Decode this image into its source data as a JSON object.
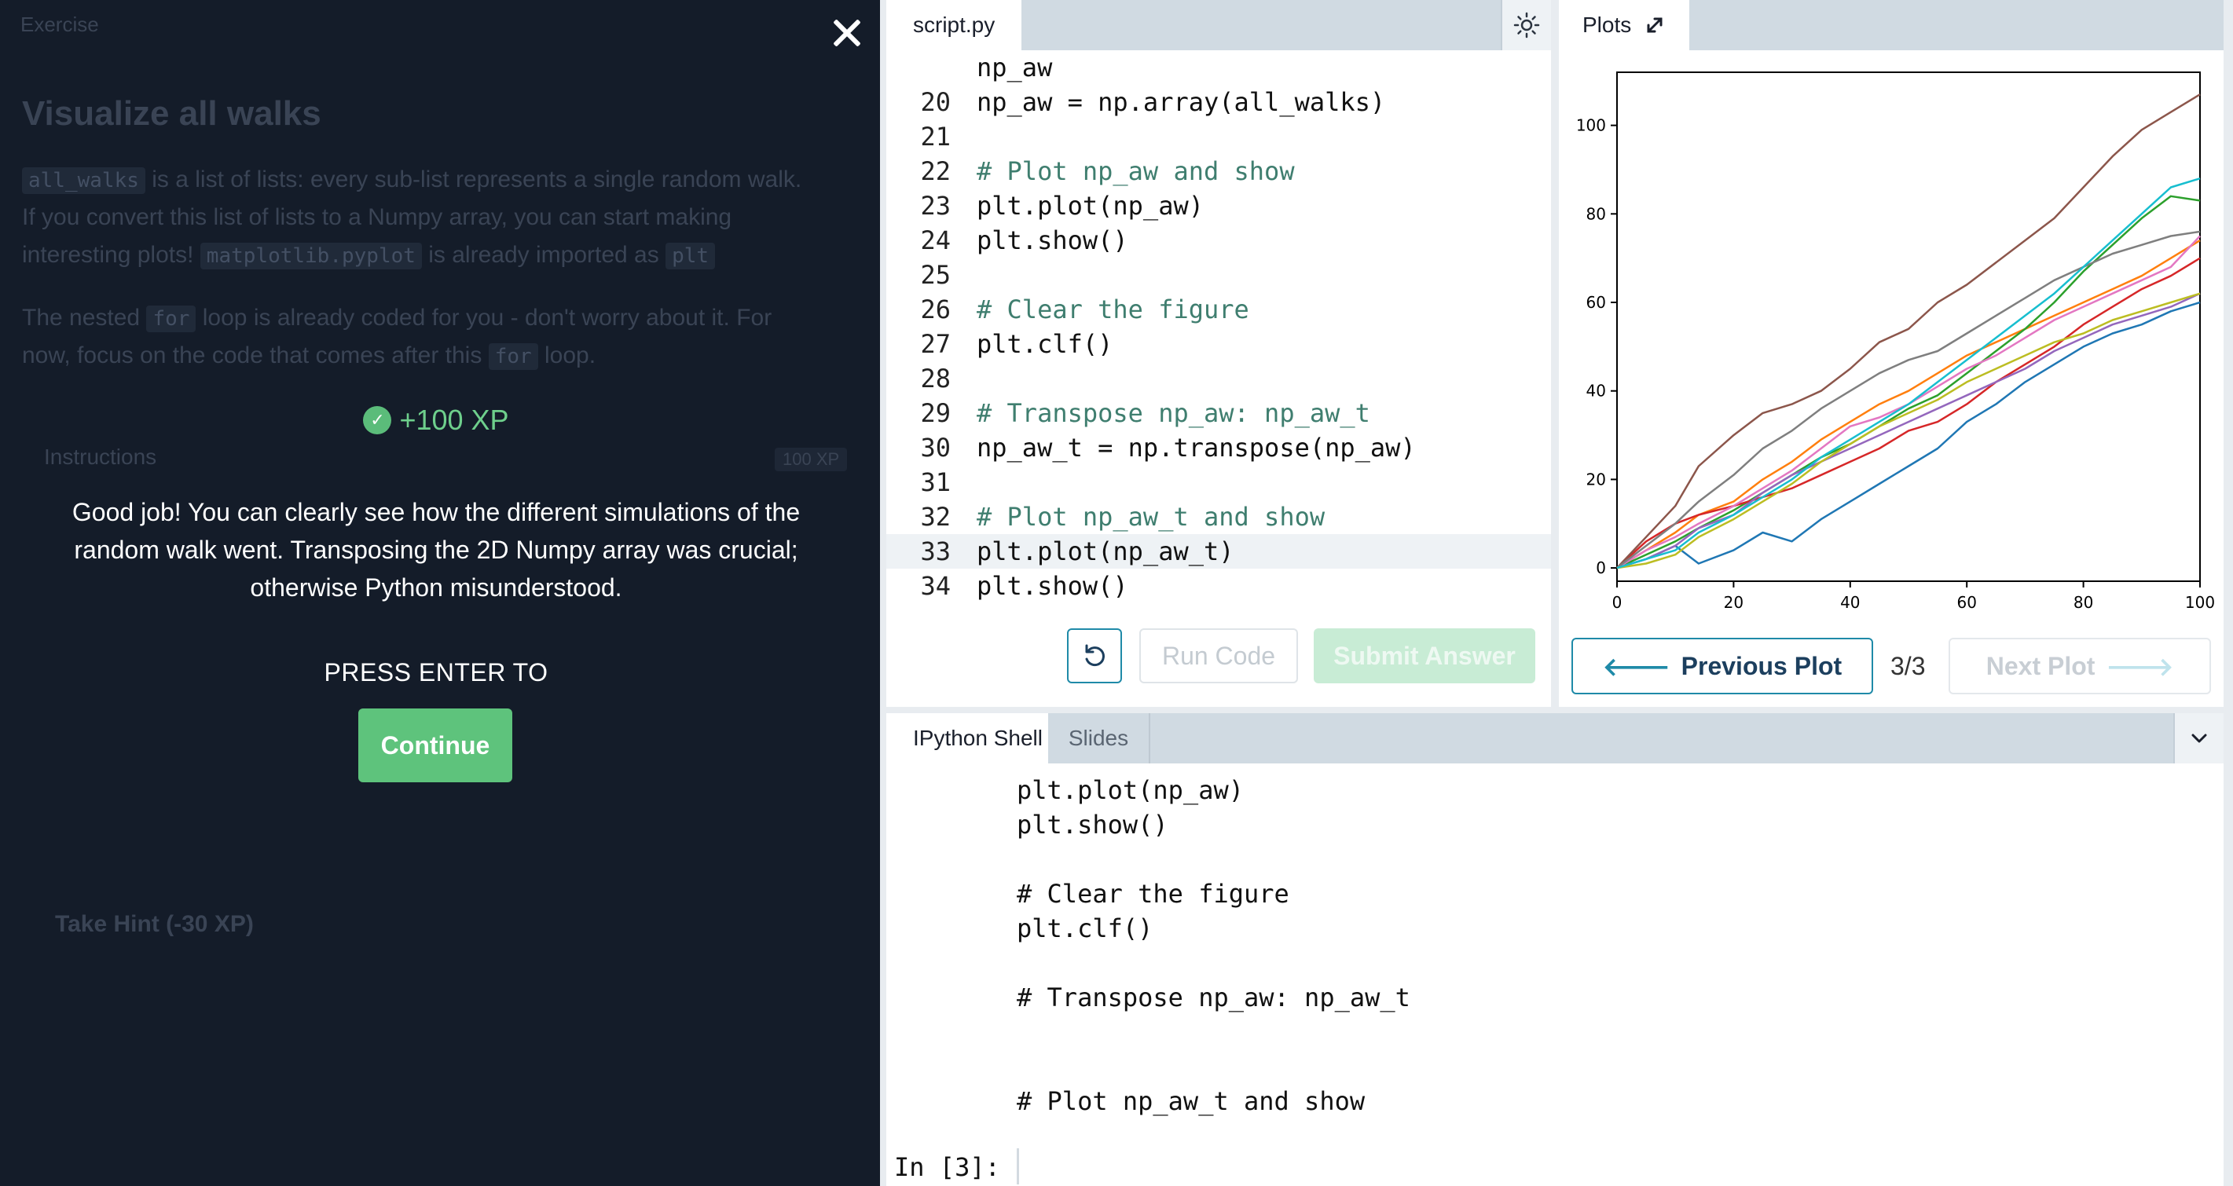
{
  "exercise": {
    "section_label": "Exercise",
    "title": "Visualize all walks",
    "para1_code": "all_walks",
    "para1_a": "is a list of lists: every sub-list represents a single random walk.",
    "para1_b": "If you convert this list of lists to a Numpy array, you can start making",
    "para1_c": "interesting plots!",
    "para1_code2": "matplotlib.pyplot",
    "para1_d": "is already imported as",
    "para1_code3": "plt",
    "para2_a": "The nested",
    "para2_code": "for",
    "para2_b": "loop is already coded for you - don't worry about it. For",
    "para2_c": "now, focus on the code that comes after this",
    "para2_code2": "for",
    "para2_d": "loop.",
    "instructions_label": "Instructions",
    "instructions_xp": "100 XP",
    "hint_label": "Take Hint (-30 XP)"
  },
  "overlay": {
    "xp": "+100 XP",
    "feedback": "Good job! You can clearly see how the different simulations of the random walk went. Transposing the 2D Numpy array was crucial; otherwise Python misunderstood.",
    "press_enter": "PRESS ENTER TO",
    "continue_label": "Continue"
  },
  "editor": {
    "tab_label": "script.py",
    "lines": [
      {
        "num": "",
        "text": "np_aw",
        "comment": false
      },
      {
        "num": "20",
        "text": "np_aw = np.array(all_walks)",
        "comment": false
      },
      {
        "num": "21",
        "text": "",
        "comment": false
      },
      {
        "num": "22",
        "text": "# Plot np_aw and show",
        "comment": true
      },
      {
        "num": "23",
        "text": "plt.plot(np_aw)",
        "comment": false
      },
      {
        "num": "24",
        "text": "plt.show()",
        "comment": false
      },
      {
        "num": "25",
        "text": "",
        "comment": false
      },
      {
        "num": "26",
        "text": "# Clear the figure",
        "comment": true
      },
      {
        "num": "27",
        "text": "plt.clf()",
        "comment": false
      },
      {
        "num": "28",
        "text": "",
        "comment": false
      },
      {
        "num": "29",
        "text": "# Transpose np_aw: np_aw_t",
        "comment": true
      },
      {
        "num": "30",
        "text": "np_aw_t = np.transpose(np_aw)",
        "comment": false
      },
      {
        "num": "31",
        "text": "",
        "comment": false
      },
      {
        "num": "32",
        "text": "# Plot np_aw_t and show",
        "comment": true
      },
      {
        "num": "33",
        "text": "plt.plot(np_aw_t)",
        "comment": false
      },
      {
        "num": "34",
        "text": "plt.show()",
        "comment": false
      }
    ],
    "active_line": 14,
    "run_label": "Run Code",
    "submit_label": "Submit Answer"
  },
  "plots": {
    "tab_label": "Plots",
    "prev_label": "Previous Plot",
    "count": "3/3",
    "next_label": "Next Plot"
  },
  "shell": {
    "tab_ipython": "IPython Shell",
    "tab_slides": "Slides",
    "lines": [
      "plt.plot(np_aw)",
      "plt.show()",
      "",
      "# Clear the figure",
      "plt.clf()",
      "",
      "# Transpose np_aw: np_aw_t",
      "",
      "",
      "# Plot np_aw_t and show"
    ],
    "prompt": "In [3]:"
  },
  "chart_data": {
    "type": "line",
    "xlim": [
      0,
      100
    ],
    "ylim": [
      -3,
      112
    ],
    "x_ticks": [
      0,
      20,
      40,
      60,
      80,
      100
    ],
    "y_ticks": [
      0,
      20,
      40,
      60,
      80,
      100
    ],
    "grid": false,
    "series": [
      {
        "color": "#1f77b4",
        "x": [
          0,
          5,
          10,
          14,
          20,
          25,
          30,
          35,
          40,
          45,
          50,
          55,
          60,
          65,
          70,
          75,
          80,
          85,
          90,
          95,
          100
        ],
        "y": [
          0,
          2,
          5,
          1,
          4,
          8,
          6,
          11,
          15,
          19,
          23,
          27,
          33,
          37,
          42,
          46,
          50,
          53,
          55,
          58,
          60
        ]
      },
      {
        "color": "#ff7f0e",
        "x": [
          0,
          5,
          10,
          14,
          20,
          25,
          30,
          35,
          40,
          45,
          50,
          55,
          60,
          65,
          70,
          75,
          80,
          85,
          90,
          95,
          100
        ],
        "y": [
          0,
          4,
          8,
          12,
          15,
          20,
          24,
          29,
          33,
          37,
          40,
          44,
          48,
          51,
          54,
          57,
          60,
          63,
          66,
          70,
          74
        ]
      },
      {
        "color": "#2ca02c",
        "x": [
          0,
          5,
          10,
          14,
          20,
          25,
          30,
          35,
          40,
          45,
          50,
          55,
          60,
          65,
          70,
          75,
          80,
          85,
          90,
          95,
          100
        ],
        "y": [
          0,
          3,
          6,
          9,
          13,
          17,
          21,
          25,
          28,
          32,
          36,
          39,
          44,
          49,
          54,
          60,
          67,
          73,
          79,
          84,
          83
        ]
      },
      {
        "color": "#d62728",
        "x": [
          0,
          5,
          10,
          14,
          20,
          25,
          30,
          35,
          40,
          45,
          50,
          55,
          60,
          65,
          70,
          75,
          80,
          85,
          90,
          95,
          100
        ],
        "y": [
          0,
          6,
          10,
          12,
          14,
          16,
          18,
          21,
          24,
          27,
          31,
          33,
          37,
          42,
          46,
          50,
          55,
          59,
          63,
          66,
          70
        ]
      },
      {
        "color": "#9467bd",
        "x": [
          0,
          5,
          10,
          14,
          20,
          25,
          30,
          35,
          40,
          45,
          50,
          55,
          60,
          65,
          70,
          75,
          80,
          85,
          90,
          95,
          100
        ],
        "y": [
          0,
          2,
          5,
          9,
          12,
          17,
          21,
          24,
          27,
          30,
          33,
          36,
          39,
          42,
          45,
          49,
          52,
          55,
          57,
          59,
          62
        ]
      },
      {
        "color": "#8c564b",
        "x": [
          0,
          5,
          10,
          14,
          20,
          25,
          30,
          35,
          40,
          45,
          50,
          55,
          60,
          65,
          70,
          75,
          80,
          85,
          90,
          95,
          100
        ],
        "y": [
          0,
          7,
          14,
          23,
          30,
          35,
          37,
          40,
          45,
          51,
          54,
          60,
          64,
          69,
          74,
          79,
          86,
          93,
          99,
          103,
          107
        ]
      },
      {
        "color": "#e377c2",
        "x": [
          0,
          5,
          10,
          14,
          20,
          25,
          30,
          35,
          40,
          45,
          50,
          55,
          60,
          65,
          70,
          75,
          80,
          85,
          90,
          95,
          100
        ],
        "y": [
          0,
          4,
          7,
          10,
          14,
          18,
          22,
          27,
          32,
          34,
          37,
          41,
          45,
          48,
          52,
          56,
          59,
          62,
          65,
          68,
          75
        ]
      },
      {
        "color": "#7f7f7f",
        "x": [
          0,
          5,
          10,
          14,
          20,
          25,
          30,
          35,
          40,
          45,
          50,
          55,
          60,
          65,
          70,
          75,
          80,
          85,
          90,
          95,
          100
        ],
        "y": [
          0,
          5,
          10,
          15,
          21,
          27,
          31,
          36,
          40,
          44,
          47,
          49,
          53,
          57,
          61,
          65,
          68,
          71,
          73,
          75,
          76
        ]
      },
      {
        "color": "#bcbd22",
        "x": [
          0,
          5,
          10,
          14,
          20,
          25,
          30,
          35,
          40,
          45,
          50,
          55,
          60,
          65,
          70,
          75,
          80,
          85,
          90,
          95,
          100
        ],
        "y": [
          0,
          1,
          3,
          7,
          11,
          15,
          19,
          24,
          28,
          32,
          35,
          38,
          42,
          45,
          48,
          51,
          53,
          56,
          58,
          60,
          62
        ]
      },
      {
        "color": "#17becf",
        "x": [
          0,
          5,
          10,
          14,
          20,
          25,
          30,
          35,
          40,
          45,
          50,
          55,
          60,
          65,
          70,
          75,
          80,
          85,
          90,
          95,
          100
        ],
        "y": [
          0,
          2,
          4,
          8,
          12,
          16,
          20,
          25,
          29,
          33,
          37,
          42,
          47,
          52,
          57,
          62,
          68,
          74,
          80,
          86,
          88
        ]
      }
    ]
  }
}
